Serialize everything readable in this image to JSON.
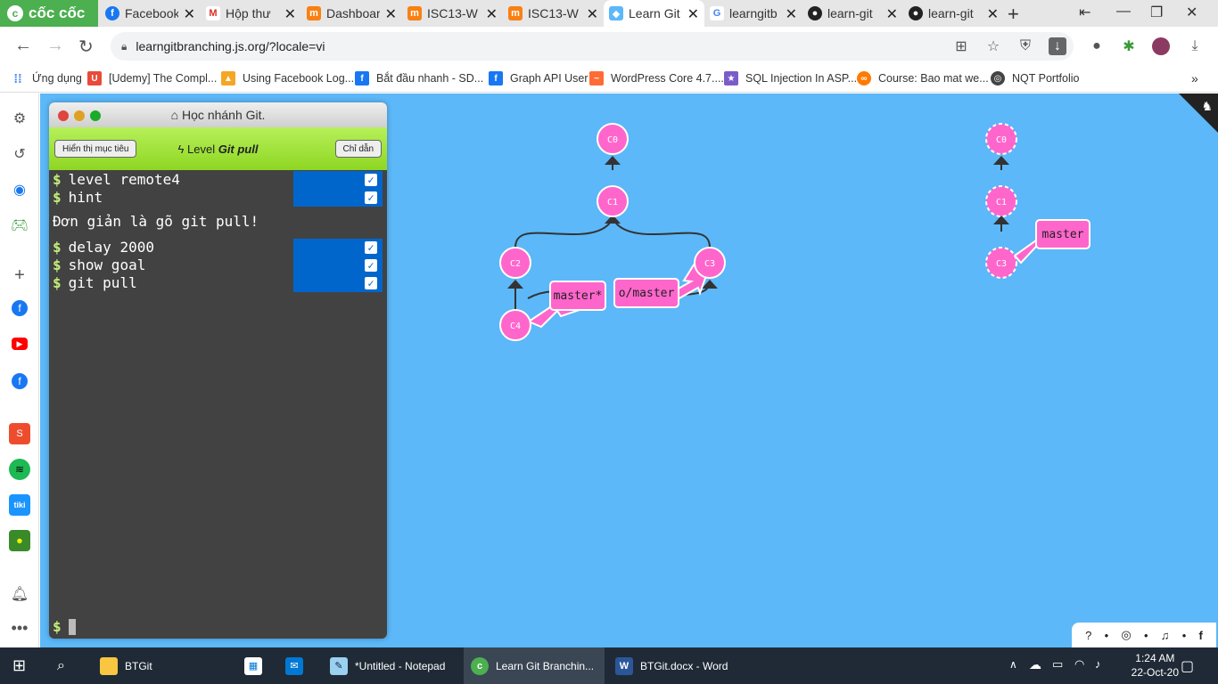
{
  "browser": {
    "brand": "cốc cốc",
    "tabs": [
      {
        "label": "Facebook",
        "icon": "facebook-icon",
        "color": "#1877f2"
      },
      {
        "label": "Hộp thư",
        "icon": "gmail-icon",
        "color": "#d93025"
      },
      {
        "label": "Dashboard",
        "icon": "moodle-icon",
        "color": "#f98012"
      },
      {
        "label": "ISC13-W",
        "icon": "moodle-icon",
        "color": "#f98012"
      },
      {
        "label": "ISC13-W",
        "icon": "moodle-icon",
        "color": "#f98012"
      },
      {
        "label": "Learn Git",
        "icon": "learngit-icon",
        "color": "#5cb8f8"
      },
      {
        "label": "learngitb",
        "icon": "google-icon",
        "color": "#4285f4"
      },
      {
        "label": "learn-git",
        "icon": "github-icon",
        "color": "#222222"
      },
      {
        "label": "learn-git",
        "icon": "github-icon",
        "color": "#222222"
      }
    ],
    "url": "learngitbranching.js.org/?locale=vi",
    "bookmarks": [
      {
        "label": "Ứng dụng",
        "color": "#4285f4"
      },
      {
        "label": "[Udemy] The Compl...",
        "color": "#e84b3a"
      },
      {
        "label": "Using Facebook Log...",
        "color": "#f5a623"
      },
      {
        "label": "Bắt đầu nhanh - SD...",
        "color": "#1877f2"
      },
      {
        "label": "Graph API User",
        "color": "#1877f2"
      },
      {
        "label": "WordPress Core 4.7....",
        "color": "#ff6b35"
      },
      {
        "label": "SQL Injection In ASP...",
        "color": "#7a5cc8"
      },
      {
        "label": "Course: Bao mat we...",
        "color": "#ff7a00"
      },
      {
        "label": "NQT Portfolio",
        "color": "#444444"
      }
    ]
  },
  "terminal": {
    "title": "Học nhánh Git.",
    "show_goal_btn": "Hiển thị mục tiêu",
    "level_prefix": "Level",
    "level_name": "Git pull",
    "hint_btn": "Chỉ dẫn",
    "commands_top": [
      "level remote4",
      "hint"
    ],
    "hint_text": "Đơn giản là gõ git pull!",
    "commands_bottom": [
      "delay 2000",
      "show goal",
      "git pull"
    ],
    "prompt": "$"
  },
  "graph": {
    "commits": [
      "C0",
      "C1",
      "C2",
      "C3",
      "C4"
    ],
    "branches": [
      "master*",
      "o/master"
    ]
  },
  "goal": {
    "commits": [
      "C0",
      "C1",
      "C3"
    ],
    "branches": [
      "master"
    ]
  },
  "taskbar": {
    "items": [
      "BTGit",
      "*Untitled - Notepad",
      "Learn Git Branchin...",
      "BTGit.docx - Word"
    ],
    "time": "1:24 AM",
    "date": "22-Oct-20"
  }
}
